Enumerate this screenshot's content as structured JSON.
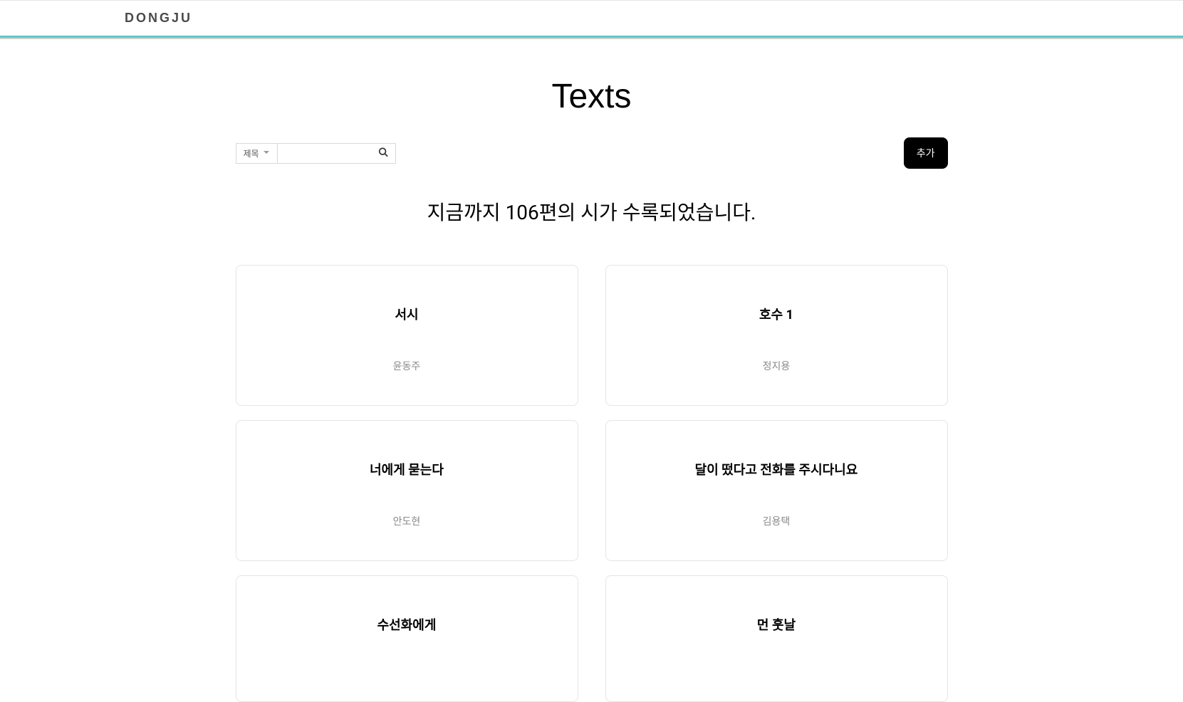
{
  "header": {
    "brand": "DONGJU"
  },
  "page": {
    "title": "Texts",
    "summary": "지금까지 106편의 시가 수록되었습니다."
  },
  "search": {
    "filter_label": "제목",
    "placeholder": ""
  },
  "actions": {
    "add_label": "추가"
  },
  "cards": [
    {
      "title": "서시",
      "author": "윤동주"
    },
    {
      "title": "호수 1",
      "author": "정지용"
    },
    {
      "title": "너에게 묻는다",
      "author": "안도현"
    },
    {
      "title": "달이 떴다고 전화를 주시다니요",
      "author": "김용택"
    },
    {
      "title": "수선화에게",
      "author": ""
    },
    {
      "title": "먼 훗날",
      "author": ""
    }
  ]
}
